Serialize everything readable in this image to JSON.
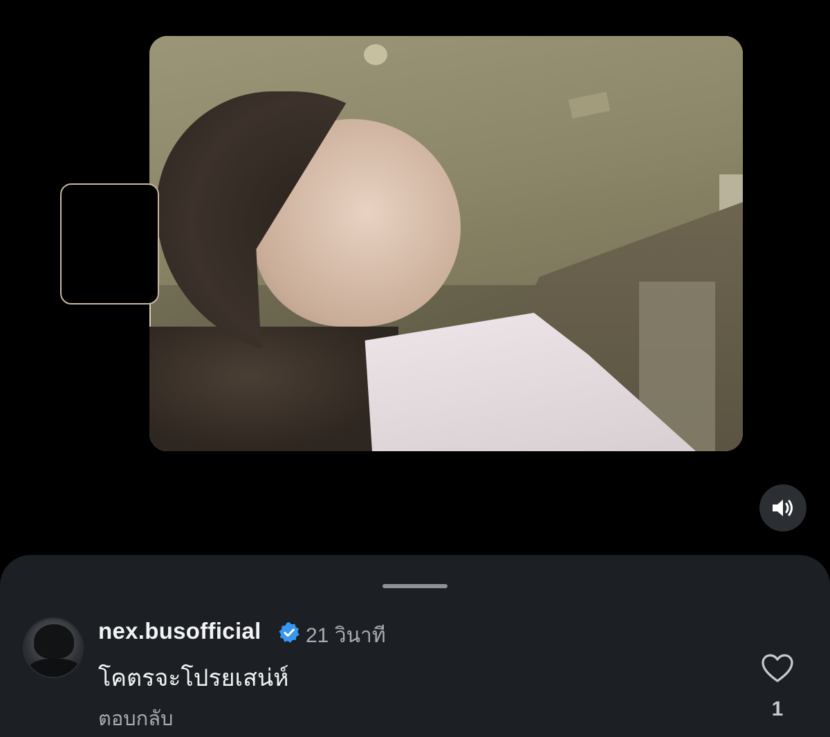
{
  "comment": {
    "username": "nex.busofficial",
    "time": "21 วินาที",
    "text": "โคตรจะโปรยเสน่ห์",
    "reply_label": "ตอบกลับ",
    "like_count": "1",
    "verified": true
  },
  "icons": {
    "sound": "speaker-icon",
    "verified": "verified-badge-icon",
    "like": "heart-icon"
  },
  "colors": {
    "sheet_background": "#1c1f23",
    "verified_blue": "#3897f0",
    "text_primary": "#f2f3f5",
    "text_secondary": "#a8acb2"
  }
}
